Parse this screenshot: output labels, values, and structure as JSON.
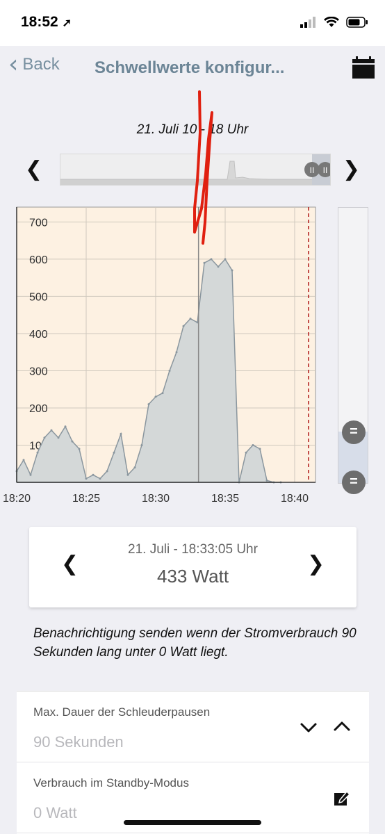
{
  "status_bar": {
    "time": "18:52",
    "icons": [
      "location-arrow-icon",
      "cellular-signal-icon",
      "wifi-icon",
      "battery-icon"
    ]
  },
  "nav": {
    "back_label": "Back",
    "title": "Schwellwerte konfigur...",
    "calendar_icon": "calendar-icon"
  },
  "range_label": "21. Juli 10 - 18 Uhr",
  "colors": {
    "background": "#efeff4",
    "nav_text": "#6c8596",
    "chart_shading": "#fdf1e2",
    "series_fill": "#d4d8d8",
    "series_line": "#8a969e",
    "marker": "#b01818",
    "scribble": "#e02010"
  },
  "chart_data": {
    "type": "area",
    "ylim": [
      0,
      740
    ],
    "yticks": [
      100,
      200,
      300,
      400,
      500,
      600,
      700
    ],
    "xlim": [
      "18:20",
      "18:41"
    ],
    "xticks": [
      "18:20",
      "18:25",
      "18:30",
      "18:35",
      "18:40"
    ],
    "selected_time": "18:33:05",
    "marker_time": "18:41",
    "grid": true,
    "series": [
      {
        "x": [
          "18:20:00",
          "18:20:30",
          "18:21:00",
          "18:21:30",
          "18:22:00",
          "18:22:30",
          "18:23:00",
          "18:23:30",
          "18:24:00",
          "18:24:30",
          "18:25:00",
          "18:25:30",
          "18:26:00",
          "18:26:30",
          "18:27:00",
          "18:27:30",
          "18:28:00",
          "18:28:30",
          "18:29:00",
          "18:29:30",
          "18:30:00",
          "18:30:30",
          "18:31:00",
          "18:31:30",
          "18:32:00",
          "18:32:30",
          "18:33:00",
          "18:33:30",
          "18:34:00",
          "18:34:30",
          "18:35:00",
          "18:35:30",
          "18:36:00",
          "18:36:30",
          "18:37:00",
          "18:37:30",
          "18:38:00",
          "18:38:30",
          "18:39:00"
        ],
        "values": [
          30,
          60,
          20,
          80,
          120,
          140,
          120,
          150,
          110,
          90,
          10,
          20,
          10,
          30,
          80,
          130,
          20,
          40,
          100,
          210,
          230,
          240,
          300,
          350,
          420,
          440,
          430,
          590,
          600,
          580,
          600,
          570,
          0,
          80,
          100,
          90,
          5,
          0,
          0
        ]
      }
    ]
  },
  "readout": {
    "time": "21. Juli - 18:33:05 Uhr",
    "value": "433 Watt"
  },
  "notification_text": "Benachrichtigung senden wenn der Stromverbrauch 90 Sekunden lang unter 0 Watt liegt.",
  "form": {
    "rows": [
      {
        "label": "Max. Dauer der Schleuderpausen",
        "value": "90 Sekunden"
      },
      {
        "label": "Verbrauch im Standby-Modus",
        "value": "0 Watt"
      }
    ]
  }
}
